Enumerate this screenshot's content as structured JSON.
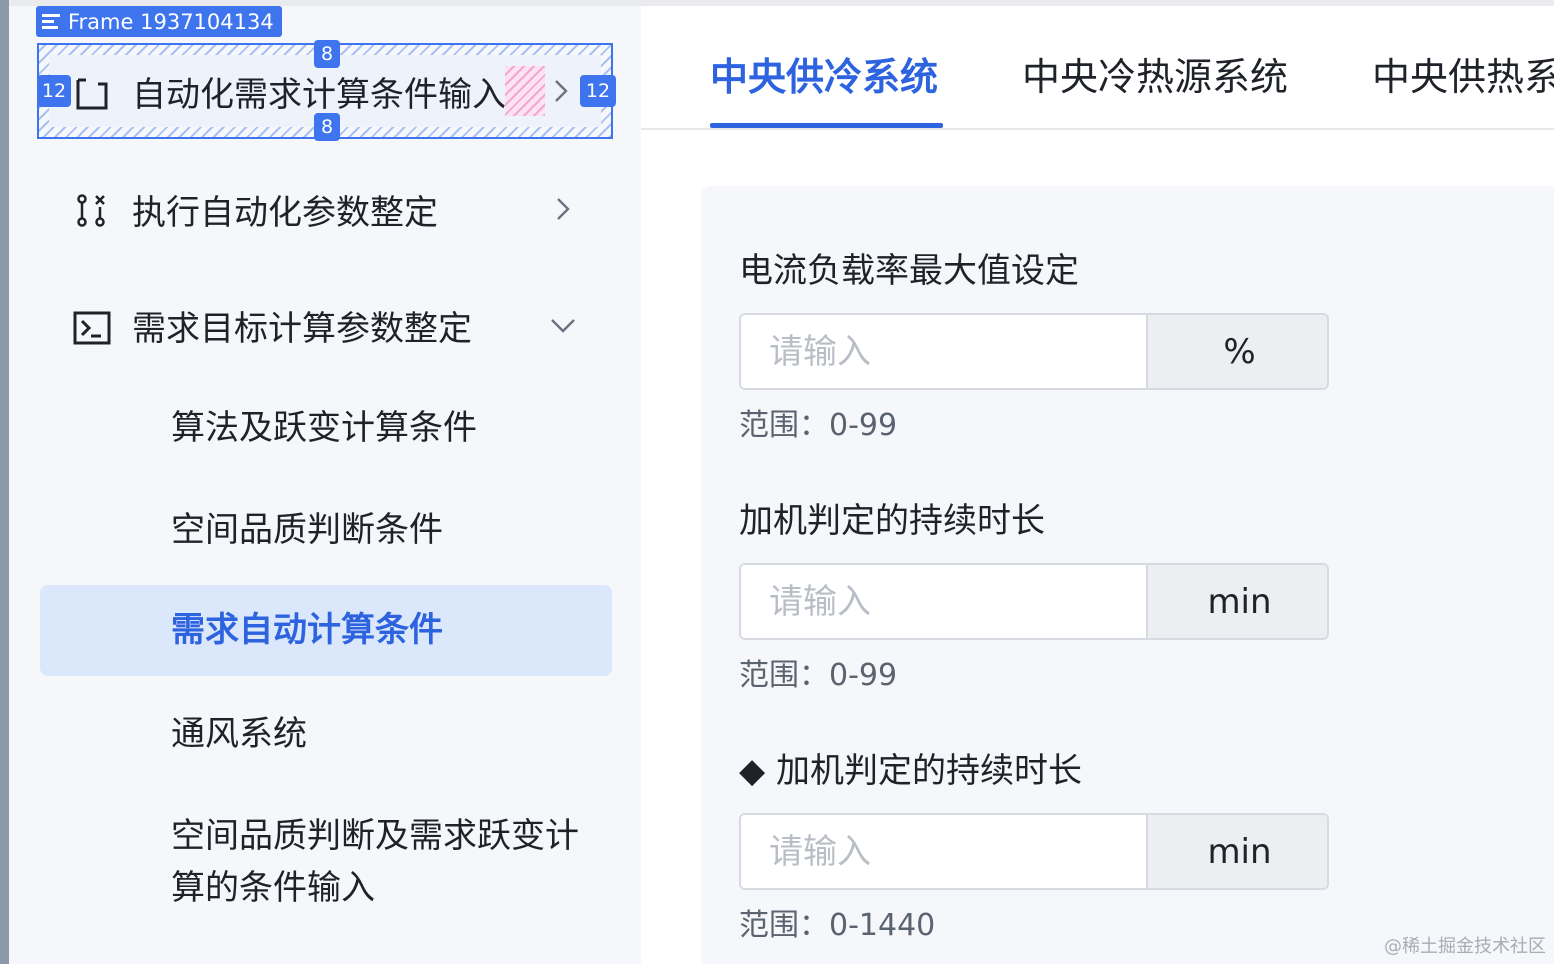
{
  "design_overlay": {
    "frame_label": "Frame 1937104134",
    "padding_top": "8",
    "padding_bottom": "8",
    "padding_left": "12",
    "padding_right": "12"
  },
  "sidebar": {
    "groups": [
      {
        "label": "自动化需求计算条件输入",
        "icon": "bracket-frame-icon",
        "arrow": "chevron-right-icon"
      },
      {
        "label": "执行自动化参数整定",
        "icon": "params-icon",
        "arrow": "chevron-right-icon"
      },
      {
        "label": "需求目标计算参数整定",
        "icon": "terminal-icon",
        "arrow": "chevron-down-icon"
      }
    ],
    "sub_items": [
      {
        "label": "算法及跃变计算条件"
      },
      {
        "label": "空间品质判断条件"
      },
      {
        "label": "需求自动计算条件",
        "active": true
      },
      {
        "label": "通风系统"
      },
      {
        "label": "空间品质判断及需求跃变计",
        "label2": "算的条件输入"
      }
    ]
  },
  "tabs": [
    {
      "label": "中央供冷系统",
      "active": true
    },
    {
      "label": "中央冷热源系统"
    },
    {
      "label": "中央供热系统"
    }
  ],
  "form": {
    "fields": [
      {
        "title": "电流负载率最大值设定",
        "placeholder": "请输入",
        "unit": "%",
        "hint": "范围：0-99"
      },
      {
        "title": "加机判定的持续时长",
        "placeholder": "请输入",
        "unit": "min",
        "hint": "范围：0-99"
      },
      {
        "title": "加机判定的持续时长",
        "bullet": "◆",
        "placeholder": "请输入",
        "unit": "min",
        "hint": "范围：0-1440"
      }
    ]
  },
  "watermark": "@稀土掘金技术社区",
  "colors": {
    "accent": "#2e63e0",
    "active_bg": "#dbe7fb",
    "figma_blue": "#3e74ee"
  }
}
